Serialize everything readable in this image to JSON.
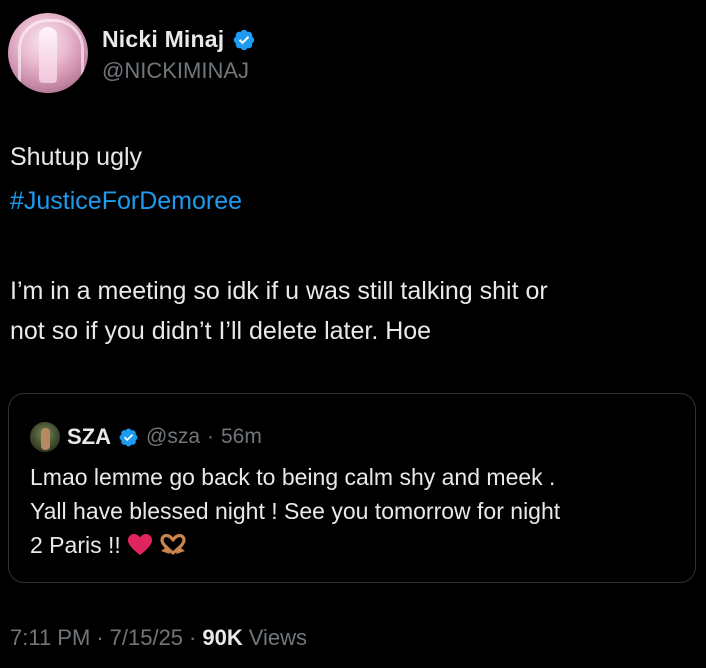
{
  "author": {
    "name": "Nicki Minaj",
    "handle": "@NICKIMINAJ",
    "verified_icon": "verified-badge-icon",
    "avatar_icon": "avatar"
  },
  "tweet": {
    "line1": "Shutup ugly",
    "hashtag": "#JusticeForDemoree",
    "line3": "I’m in a meeting so idk if u was still talking shit or",
    "line4": "not so if you didn’t I’ll delete later. Hoe"
  },
  "quoted": {
    "name": "SZA",
    "handle": "@sza",
    "separator": "·",
    "time": "56m",
    "line1": "Lmao lemme go back to being calm shy and meek .",
    "line2": "Yall have blessed night ! See you tomorrow for night",
    "line3": "2 Paris !!",
    "emojis": [
      "red-heart-icon",
      "heart-hands-icon"
    ]
  },
  "meta": {
    "time": "7:11 PM",
    "sep1": "·",
    "date": "7/15/25",
    "sep2": "·",
    "views_count": "90K",
    "views_label": "Views"
  },
  "colors": {
    "background": "#000000",
    "text": "#e7e9ea",
    "secondary": "#71767b",
    "accent": "#1d9bf0"
  }
}
